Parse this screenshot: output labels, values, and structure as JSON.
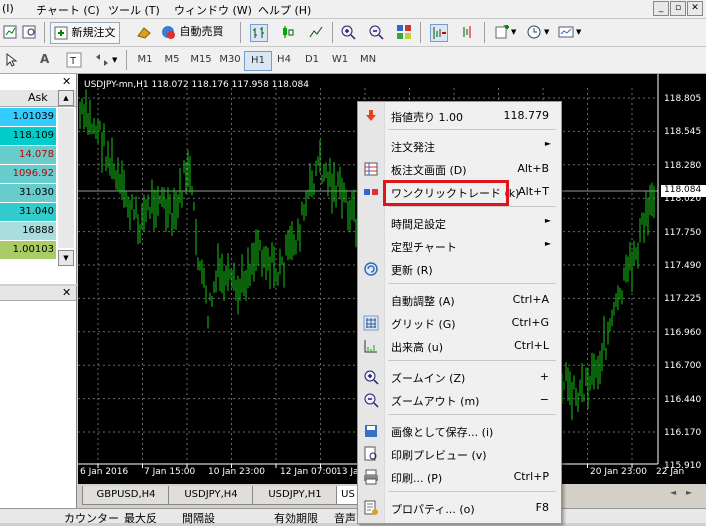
{
  "menubar": {
    "items": [
      "(I)",
      "チャート (C)",
      "ツール (T)",
      "ウィンドウ (W)",
      "ヘルプ (H)"
    ],
    "window_buttons": [
      "_",
      "▫",
      "✕"
    ]
  },
  "toolbar1": {
    "new_order": "新規注文",
    "auto_trade": "自動売買"
  },
  "toolbar2": {
    "timeframes": [
      "M1",
      "M5",
      "M15",
      "M30",
      "H1",
      "H4",
      "D1",
      "W1",
      "MN"
    ],
    "active_timeframe": "H1"
  },
  "market_watch": {
    "column": "Ask",
    "asks": [
      "1.01039",
      "118.109",
      "14.078",
      "1096.92",
      "31.030",
      "31.040",
      "16888",
      "1.00103"
    ],
    "colors": [
      "#33ccff",
      "#00cccc",
      "#66cccc",
      "#66cccc",
      "#66cccc",
      "#33cccc",
      "#aadddd",
      "#aacc66"
    ]
  },
  "chart": {
    "header": "USDJPY-mn,H1  118.072 118.176 117.958 118.084",
    "current_price": "118.084",
    "price_labels": [
      "118.805",
      "118.545",
      "118.280",
      "118.020",
      "117.750",
      "117.490",
      "117.225",
      "116.960",
      "116.700",
      "116.440",
      "116.170",
      "115.910"
    ],
    "time_labels": [
      "6 Jan 2016",
      "7 Jan 15:00",
      "10 Jan 23:00",
      "12 Jan 07:00",
      "13 Ja",
      "20 Jan 23:00",
      "22 Jan"
    ]
  },
  "tabs": [
    "GBPUSD,H4",
    "USDJPY,H4",
    "USDJPY,H1",
    "US"
  ],
  "bottom_header": [
    "カウンター",
    "最大反",
    "間隔設",
    "有効期限",
    "音声"
  ],
  "context_menu": {
    "items": [
      {
        "label": "指値売り 1.00",
        "shortcut": "118.779",
        "icon": "sell-arrow-icon"
      },
      {
        "label": "注文発注",
        "shortcut": "",
        "submenu": true
      },
      {
        "label": "板注文画面 (D)",
        "shortcut": "Alt+B",
        "icon": "depth-of-market-icon"
      },
      {
        "label": "ワンクリックトレード (k)",
        "shortcut": "Alt+T",
        "icon": "one-click-trade-icon"
      },
      {
        "label": "時間足設定",
        "shortcut": "",
        "submenu": true
      },
      {
        "label": "定型チャート",
        "shortcut": "",
        "submenu": true
      },
      {
        "label": "更新 (R)",
        "shortcut": "",
        "icon": "refresh-icon"
      },
      {
        "label": "自動調整 (A)",
        "shortcut": "Ctrl+A"
      },
      {
        "label": "グリッド (G)",
        "shortcut": "Ctrl+G",
        "icon": "grid-icon"
      },
      {
        "label": "出来高 (u)",
        "shortcut": "Ctrl+L",
        "icon": "volume-icon"
      },
      {
        "label": "ズームイン (Z)",
        "shortcut": "+",
        "icon": "zoom-in-icon"
      },
      {
        "label": "ズームアウト (m)",
        "shortcut": "−",
        "icon": "zoom-out-icon"
      },
      {
        "label": "画像として保存... (i)",
        "shortcut": "",
        "icon": "save-image-icon"
      },
      {
        "label": "印刷プレビュー (v)",
        "shortcut": "",
        "icon": "print-preview-icon"
      },
      {
        "label": "印刷... (P)",
        "shortcut": "Ctrl+P",
        "icon": "print-icon"
      },
      {
        "label": "プロパティ... (o)",
        "shortcut": "F8",
        "icon": "properties-icon"
      }
    ]
  }
}
